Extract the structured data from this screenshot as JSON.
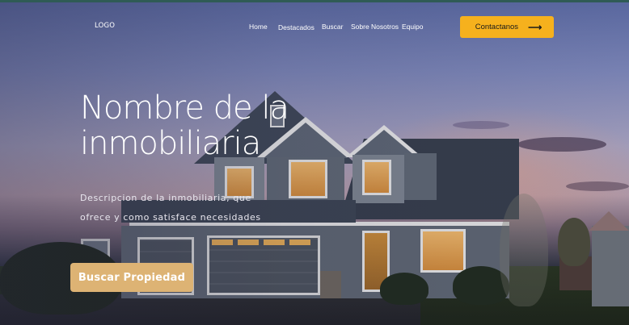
{
  "nav": {
    "logo": "LOGO",
    "links": [
      "Home",
      "Destacados",
      "Buscar",
      "Sobre Nosotros",
      "Equipo"
    ],
    "cta_label": "Contactanos",
    "cta_icon": "arrow-right-icon"
  },
  "hero": {
    "title": "Nombre de la inmobiliaria",
    "description": "Descripcion de la inmobiliaria, que ofrece y como satisface necesidades",
    "button_label": "Buscar Propiedad",
    "background": "house-at-dusk-image"
  },
  "colors": {
    "cta": "#f6b11d",
    "search_button": "#ddb374",
    "text": "#ffffff",
    "top_accent": "#2f5b55"
  }
}
